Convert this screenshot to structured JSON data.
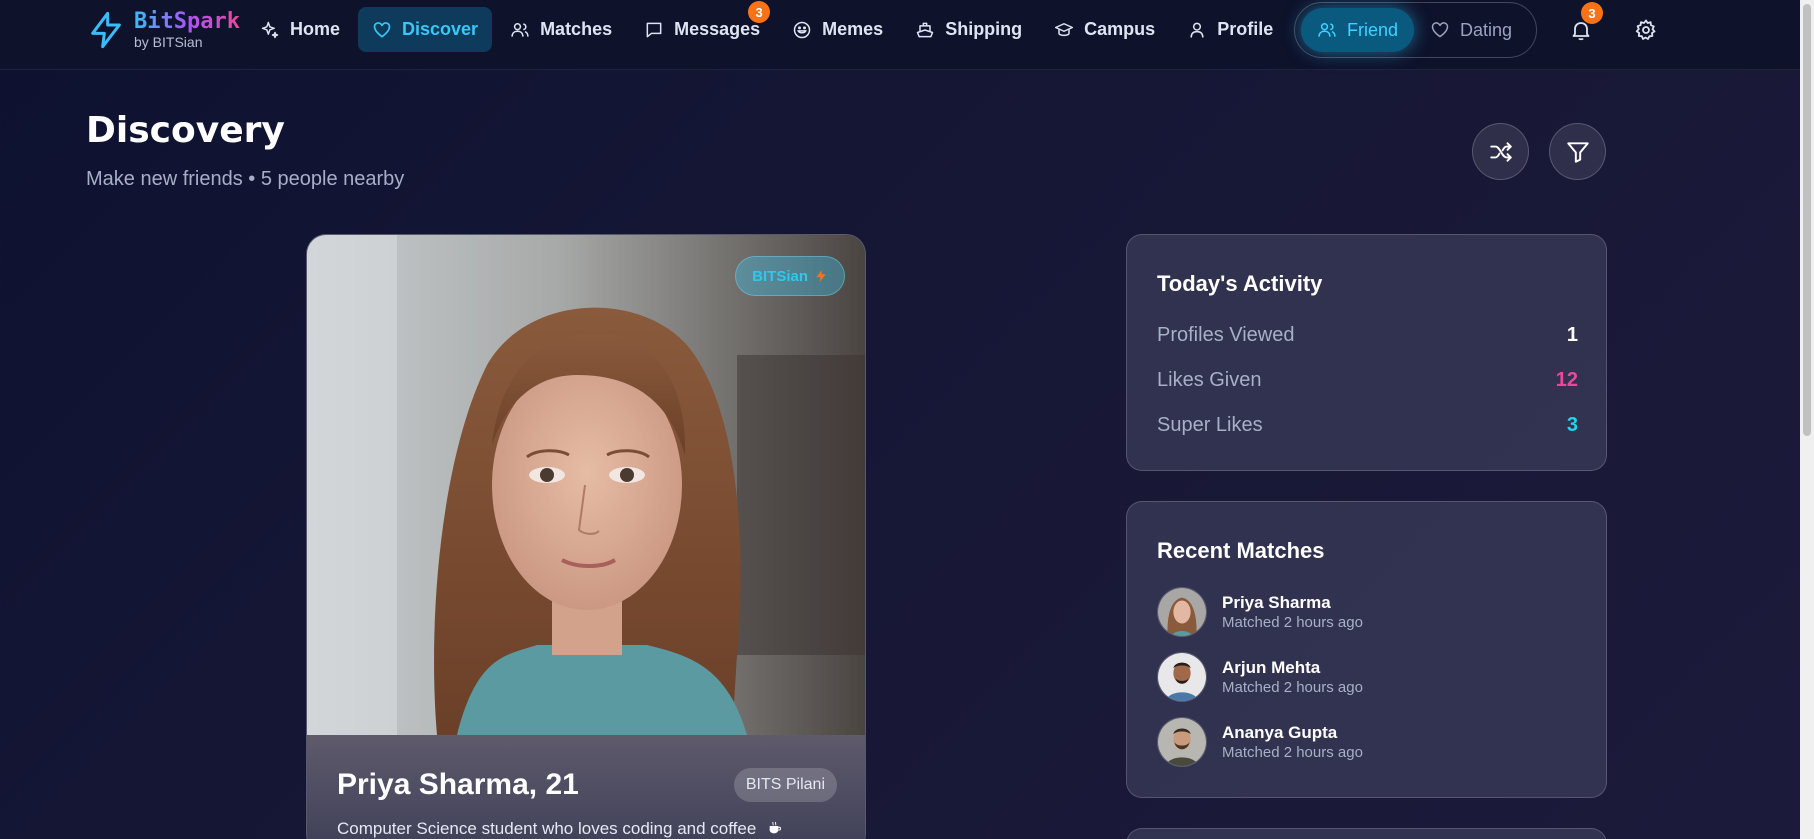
{
  "brand": {
    "name": "BitSpark",
    "sub": "by BITSian"
  },
  "nav": {
    "items": [
      {
        "label": "Home",
        "icon": "sparkles-icon"
      },
      {
        "label": "Discover",
        "icon": "heart-icon",
        "active": true
      },
      {
        "label": "Matches",
        "icon": "users-icon"
      },
      {
        "label": "Messages",
        "icon": "message-icon",
        "badge": "3"
      },
      {
        "label": "Memes",
        "icon": "smile-icon"
      },
      {
        "label": "Shipping",
        "icon": "ship-icon"
      },
      {
        "label": "Campus",
        "icon": "graduation-cap-icon"
      },
      {
        "label": "Profile",
        "icon": "user-icon"
      }
    ],
    "mode": {
      "friend": "Friend",
      "dating": "Dating",
      "selected": "Friend"
    },
    "notifications_badge": "3"
  },
  "header": {
    "title": "Discovery",
    "subtitle": "Make new friends • 5 people nearby"
  },
  "card": {
    "badge": "BITSian",
    "name": "Priya Sharma, 21",
    "college": "BITS Pilani",
    "bio": "Computer Science student who loves coding and coffee"
  },
  "activity": {
    "title": "Today's Activity",
    "stats": [
      {
        "label": "Profiles Viewed",
        "value": "1",
        "color": "#ffffff"
      },
      {
        "label": "Likes Given",
        "value": "12",
        "color": "#ec4899"
      },
      {
        "label": "Super Likes",
        "value": "3",
        "color": "#22d3ee"
      }
    ]
  },
  "matches": {
    "title": "Recent Matches",
    "items": [
      {
        "name": "Priya Sharma",
        "time": "Matched 2 hours ago"
      },
      {
        "name": "Arjun Mehta",
        "time": "Matched 2 hours ago"
      },
      {
        "name": "Ananya Gupta",
        "time": "Matched 2 hours ago"
      }
    ]
  },
  "colors": {
    "accent": "#38c8f5",
    "badge": "#f97316",
    "pink": "#ec4899"
  }
}
